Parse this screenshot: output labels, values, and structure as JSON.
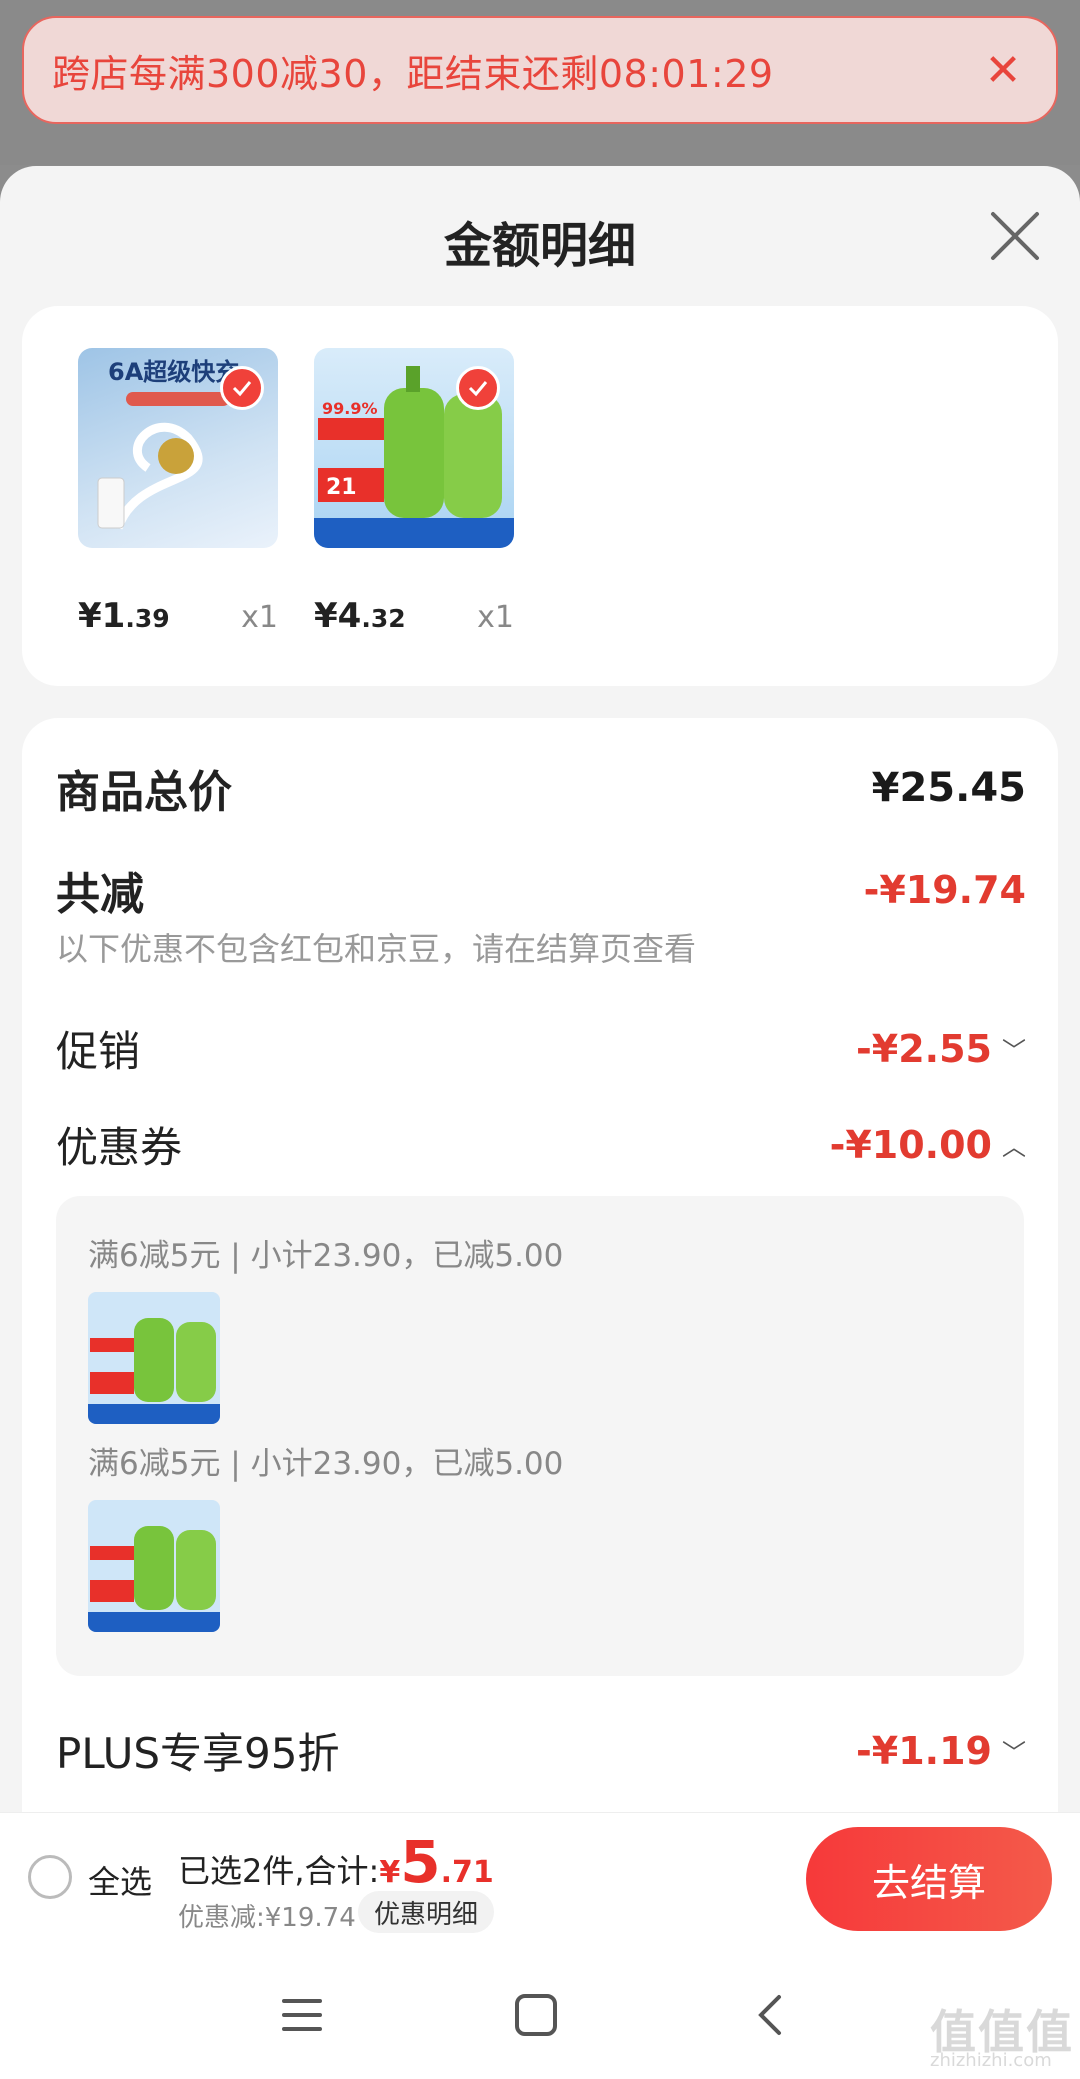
{
  "banner": {
    "text": "跨店每满300减30，距结束还剩08:01:29",
    "close_icon": "close-icon"
  },
  "sheet": {
    "title": "金额明细",
    "close_icon": "close-icon"
  },
  "products": [
    {
      "image_text": "6A超级快充",
      "price_main": "¥1",
      "price_decimal": ".39",
      "qty": "x1",
      "selected": true
    },
    {
      "image_text": "有效抑菌 99.9%",
      "price_main": "¥4",
      "price_decimal": ".32",
      "qty": "x1",
      "selected": true
    }
  ],
  "summary": {
    "total_label": "商品总价",
    "total_value": "¥25.45",
    "reduce_label": "共减",
    "reduce_value": "-¥19.74",
    "note": "以下优惠不包含红包和京豆，请在结算页查看",
    "promo_label": "促销",
    "promo_value": "-¥2.55",
    "coupon_label": "优惠券",
    "coupon_value": "-¥10.00",
    "plus_label": "PLUS专享95折",
    "plus_value": "-¥1.19"
  },
  "coupons": [
    {
      "text": "满6减5元 | 小计23.90，已减5.00"
    },
    {
      "text": "满6减5元 | 小计23.90，已减5.00"
    }
  ],
  "bottom": {
    "select_all": "全选",
    "selected_text": "已选2件,合计:",
    "yen": "¥",
    "amount_int": "5",
    "amount_dec": ".71",
    "discount": "优惠减:¥19.74",
    "detail_button": "优惠明细",
    "checkout": "去结算"
  },
  "watermark": {
    "text": "值值值",
    "sub": "zhizhizhi.com"
  },
  "colors": {
    "accent": "#e8302a",
    "banner_bg": "#f0d8d6"
  }
}
